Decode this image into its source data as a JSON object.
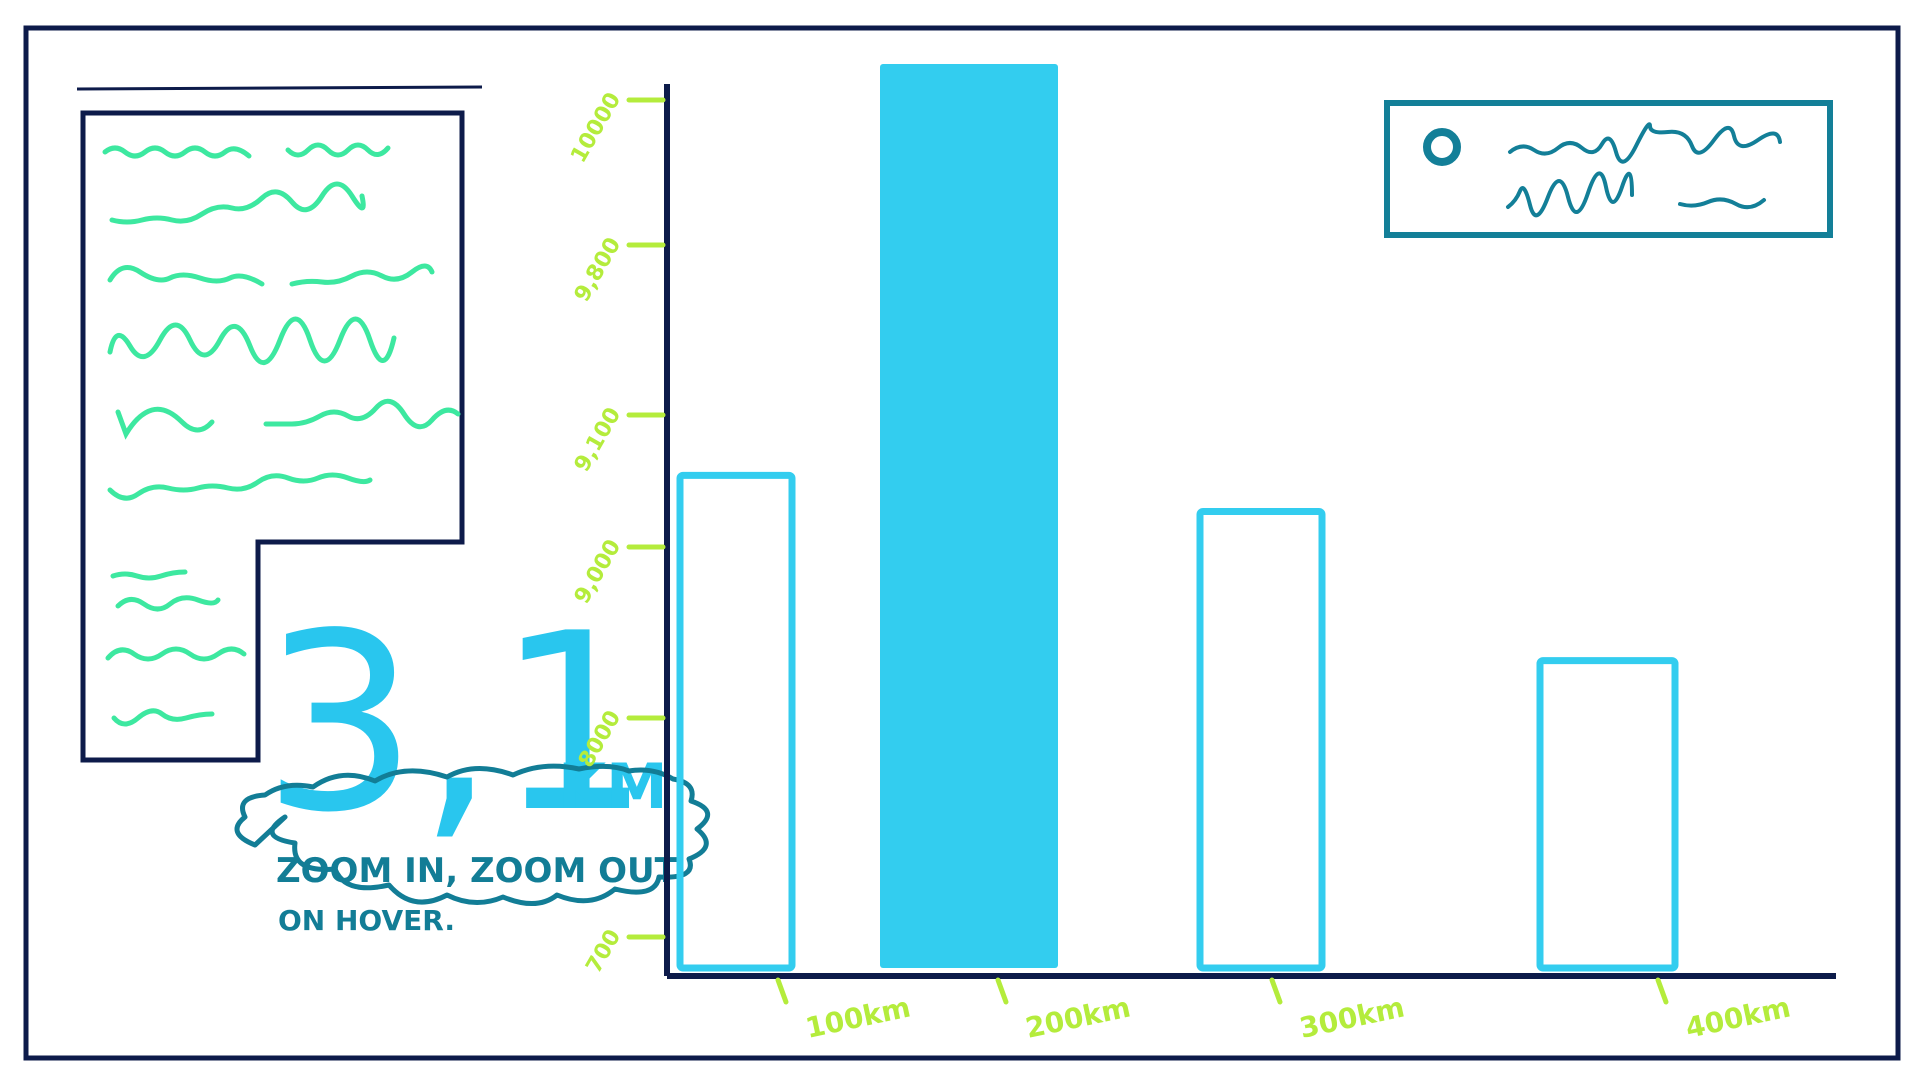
{
  "colors": {
    "frame": "#0d1b4a",
    "placeholder_text": "#3de8a0",
    "tick_label": "#b4ec3c",
    "bar": "#33cdef",
    "big_number": "#29c6ee",
    "note": "#127d96",
    "legend_border": "#137f98"
  },
  "kpi": {
    "value": "3,1",
    "unit": "KM"
  },
  "note": {
    "line1": "ZOOM IN, ZOOM OUT",
    "line2": "ON HOVER."
  },
  "chart_data": {
    "type": "bar",
    "categories": [
      "100km",
      "200km",
      "300km",
      "400km"
    ],
    "y_tick_labels": [
      "700",
      "8000",
      "9,000",
      "9,100",
      "9,800",
      "10000"
    ],
    "bar_heights": [
      0.545,
      1.0,
      0.505,
      0.34
    ],
    "highlighted_index": 1,
    "grid": false,
    "legend": "top-right"
  }
}
